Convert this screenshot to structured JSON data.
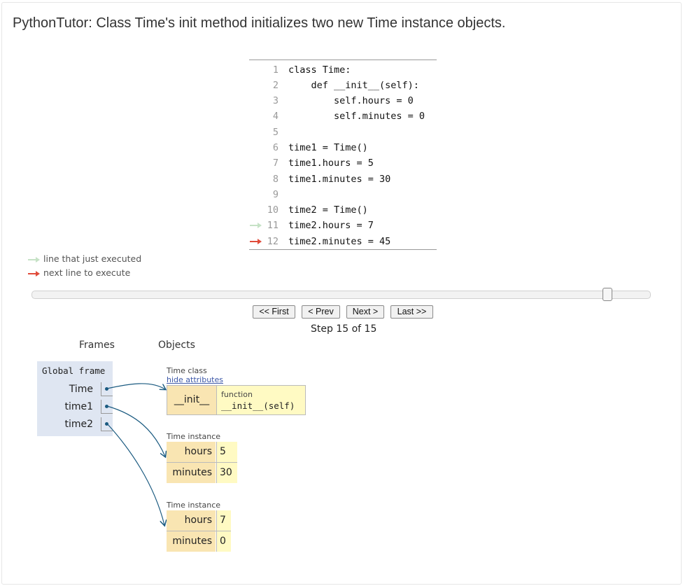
{
  "title": "PythonTutor: Class Time's init method initializes two new Time instance objects.",
  "code": {
    "lines": [
      {
        "no": "1",
        "text": "class Time:"
      },
      {
        "no": "2",
        "text": "    def __init__(self):"
      },
      {
        "no": "3",
        "text": "        self.hours = 0"
      },
      {
        "no": "4",
        "text": "        self.minutes = 0"
      },
      {
        "no": "5",
        "text": ""
      },
      {
        "no": "6",
        "text": "time1 = Time()"
      },
      {
        "no": "7",
        "text": "time1.hours = 5"
      },
      {
        "no": "8",
        "text": "time1.minutes = 30"
      },
      {
        "no": "9",
        "text": ""
      },
      {
        "no": "10",
        "text": "time2 = Time()"
      },
      {
        "no": "11",
        "text": "time2.hours = 7"
      },
      {
        "no": "12",
        "text": "time2.minutes = 45"
      }
    ],
    "executed_line": 11,
    "next_line": 12
  },
  "legend": {
    "executed": "line that just executed",
    "next": "next line to execute"
  },
  "colors": {
    "executed_arrow": "#c6e2c6",
    "next_arrow": "#e04b3a",
    "pointer": "#1a5a80",
    "frame_bg": "#dfe6f2",
    "key_bg": "#f9e5b2",
    "value_bg": "#fffac3"
  },
  "slider": {
    "position_fraction": 1.0
  },
  "nav": {
    "first": "<< First",
    "prev": "< Prev",
    "next": "Next >",
    "last": "Last >>"
  },
  "step_text": "Step 15 of 15",
  "headers": {
    "frames": "Frames",
    "objects": "Objects"
  },
  "global_frame": {
    "title": "Global frame",
    "vars": [
      "Time",
      "time1",
      "time2"
    ]
  },
  "objects": {
    "time_class": {
      "label": "Time class",
      "hide_link": "hide attributes",
      "attr_name": "__init__",
      "function_label": "function",
      "function_sig": "__init__(self)"
    },
    "instance1": {
      "label": "Time instance",
      "attrs": [
        {
          "key": "hours",
          "value": "5"
        },
        {
          "key": "minutes",
          "value": "30"
        }
      ]
    },
    "instance2": {
      "label": "Time instance",
      "attrs": [
        {
          "key": "hours",
          "value": "7"
        },
        {
          "key": "minutes",
          "value": "0"
        }
      ]
    }
  }
}
